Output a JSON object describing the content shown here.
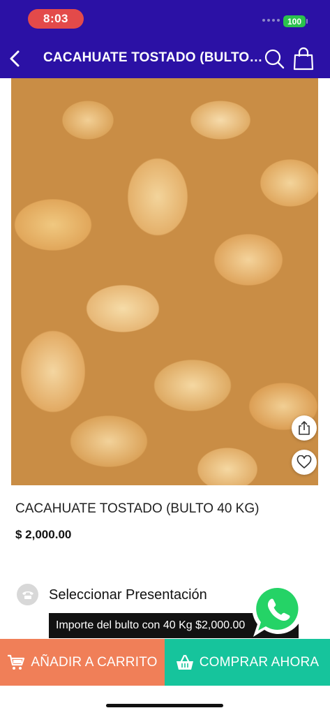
{
  "status_bar": {
    "time": "8:03",
    "battery": "100"
  },
  "nav": {
    "title": "CACAHUATE TOSTADO (BULTO 40 KG)",
    "back_icon": "chevron-left-icon",
    "search_icon": "search-icon",
    "bag_icon": "shopping-bag-icon"
  },
  "product": {
    "name": "CACAHUATE TOSTADO (BULTO 40 KG)",
    "price": "$ 2,000.00",
    "share_icon": "share-icon",
    "favorite_icon": "heart-icon"
  },
  "presentation": {
    "label": "Seleccionar Presentación",
    "selected_option": "Importe del bulto con 40 Kg  $2,000.00",
    "icon": "phone-icon"
  },
  "actions": {
    "add_to_cart": "AÑADIR A CARRITO",
    "buy_now": "COMPRAR AHORA"
  },
  "colors": {
    "header": "#2b11a5",
    "add_to_cart": "#f07f58",
    "buy_now": "#16c49c",
    "whatsapp": "#25d366",
    "time_pill": "#e34a4a",
    "battery": "#2bc24d"
  }
}
